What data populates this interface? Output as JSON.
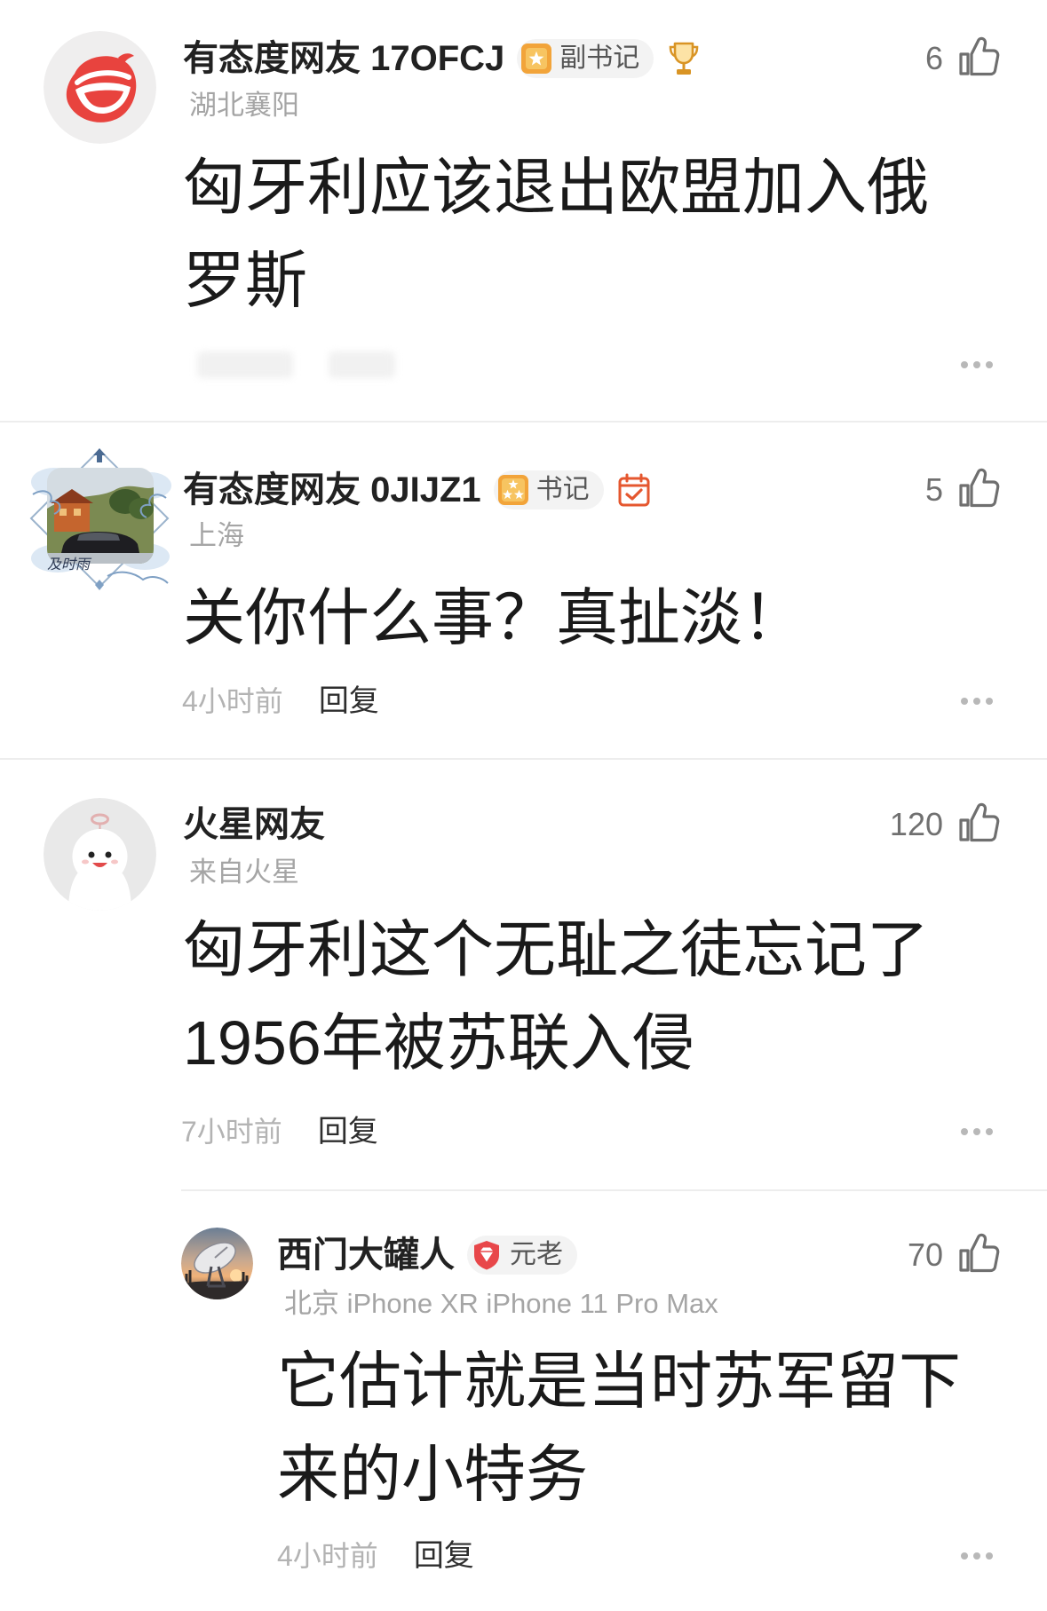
{
  "theme": {
    "divider": "#ededed",
    "username": "#222222",
    "body": "#1a1a1a",
    "meta": "#a5a5a5",
    "time": "#b3b3b3",
    "reply": "#2e2e2e",
    "like": "#707070",
    "badge_gold": "#f2a43a",
    "badge_red": "#e8474a"
  },
  "labels": {
    "reply": "回复"
  },
  "icons": {
    "like": "thumbs-up-icon",
    "more": "more-dots-icon"
  },
  "comments": [
    {
      "username": "有态度网友 17OFCJ",
      "badge": {
        "label": "副书记",
        "icon": "star-badge-icon"
      },
      "extra_icon": "trophy-icon",
      "avatar_icon": "red-logo-avatar",
      "location": "湖北襄阳",
      "likes": "6",
      "text": "匈牙利应该退出欧盟加入俄罗斯"
    },
    {
      "username": "有态度网友 0JIJZ1",
      "badge": {
        "label": "书记",
        "icon": "three-star-badge-icon"
      },
      "extra_icon": "calendar-check-icon",
      "avatar_icon": "framed-landscape-avatar",
      "avatar_text": "及时雨",
      "location": "上海",
      "likes": "5",
      "text": "关你什么事？真扯淡！",
      "time": "4小时前"
    },
    {
      "username": "火星网友",
      "avatar_icon": "mascot-avatar",
      "location": "来自火星",
      "likes": "120",
      "text": "匈牙利这个无耻之徒忘记了1956年被苏联入侵",
      "time": "7小时前"
    },
    {
      "username": "西门大罐人",
      "badge": {
        "label": "元老",
        "icon": "shield-gem-badge-icon"
      },
      "avatar_icon": "satellite-dish-avatar",
      "location": "北京 iPhone XR iPhone 11 Pro Max",
      "likes": "70",
      "text": "它估计就是当时苏军留下来的小特务",
      "time": "4小时前"
    }
  ]
}
